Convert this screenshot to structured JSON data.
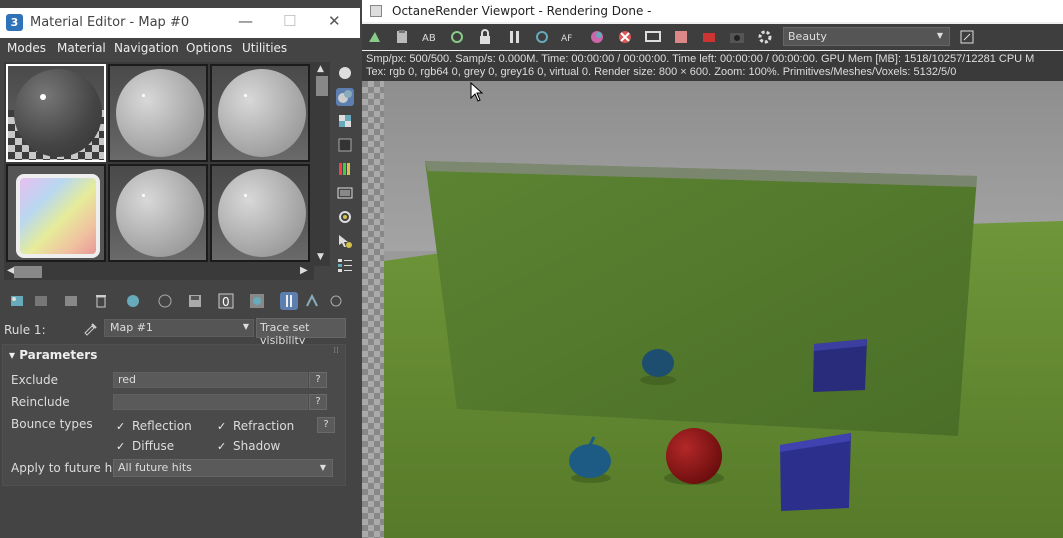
{
  "material_editor": {
    "app_icon_label": "3",
    "title": "Material Editor - Map #0",
    "window_buttons": {
      "minimize": "—",
      "maximize": "☐",
      "close": "✕"
    },
    "menu": [
      "Modes",
      "Material",
      "Navigation",
      "Options",
      "Utilities"
    ],
    "rule": {
      "label": "Rule 1:",
      "map_value": "Map #1",
      "trace_button": "Trace set visibility"
    },
    "parameters": {
      "header": "Parameters",
      "exclude_label": "Exclude",
      "exclude_value": "red",
      "reinclude_label": "Reinclude",
      "reinclude_value": "",
      "help": "?",
      "bounce_label": "Bounce types",
      "reflection": "Reflection",
      "refraction": "Refraction",
      "diffuse": "Diffuse",
      "shadow": "Shadow",
      "checkmark": "✓",
      "future_label": "Apply to future hits",
      "future_value": "All future hits"
    }
  },
  "octane": {
    "title": "OctaneRender Viewport - Rendering Done -",
    "render_pass": "Beauty",
    "stats_line1": "Smp/px: 500/500.   Samp/s: 0.000M.   Time: 00:00:00 / 00:00:00.   Time left: 00:00:00 / 00:00:00.   GPU Mem [MB]: 1518/10257/12281   CPU M",
    "stats_line2": "Tex: rgb 0, rgb64 0, grey 0, grey16 0, virtual 0.   Render size: 800 × 600.   Zoom: 100%.   Primitives/Meshes/Voxels: 5132/5/0"
  }
}
